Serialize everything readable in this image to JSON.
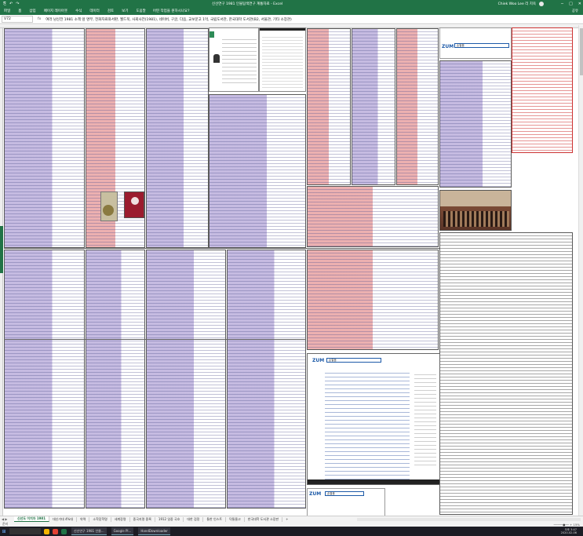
{
  "window": {
    "title": "신선연구 1981 인물탐색연구 계통자료 - Excel",
    "user": "Chiek Woo Lee 리 치욱",
    "controls": [
      "─",
      "□",
      "✕"
    ]
  },
  "quick_access": [
    "⎘",
    "↶",
    "↷"
  ],
  "ribbon": {
    "tabs": [
      "파일",
      "홈",
      "삽입",
      "페이지 레이아웃",
      "수식",
      "데이터",
      "검토",
      "보기",
      "도움말"
    ],
    "search": "어떤 작업을 원하시나요?",
    "share": "공유"
  },
  "formula_bar": {
    "name_box": "V72",
    "fx": "fx",
    "content": "여러 남신전 1981 소책 앞 명부, 전화자료와서판, 월드북, 사회사전(1981), 네이버, 구글, 다음, 교보문고 1억, 국립도서관, 한국대학 도서관(B2, 서울관, 기타 소장관)"
  },
  "embedded": {
    "zum_logo": "ZUM",
    "zum_search": "손열음"
  },
  "sheet_tabs": {
    "nav": "◀ ▶",
    "tabs": [
      "신선도 이치자 1981",
      "대신가대 4%대",
      "약력",
      "소학장학명",
      "세계장명",
      "중국지명 중록",
      "1912 일중 국호",
      "대한 검정",
      "통한 인스트",
      "덕통울고",
      "한국대학 도서관 소장판"
    ],
    "active_index": 0,
    "add": "+"
  },
  "status": {
    "left": "준비",
    "zoom": "─────●── + 15%"
  },
  "taskbar": {
    "start": "⊞",
    "apps": [
      "신선연구 1981 인물...",
      "Google Pl...",
      "HandDownloader"
    ],
    "time": "오후 3:47",
    "date": "2020-02-06"
  }
}
